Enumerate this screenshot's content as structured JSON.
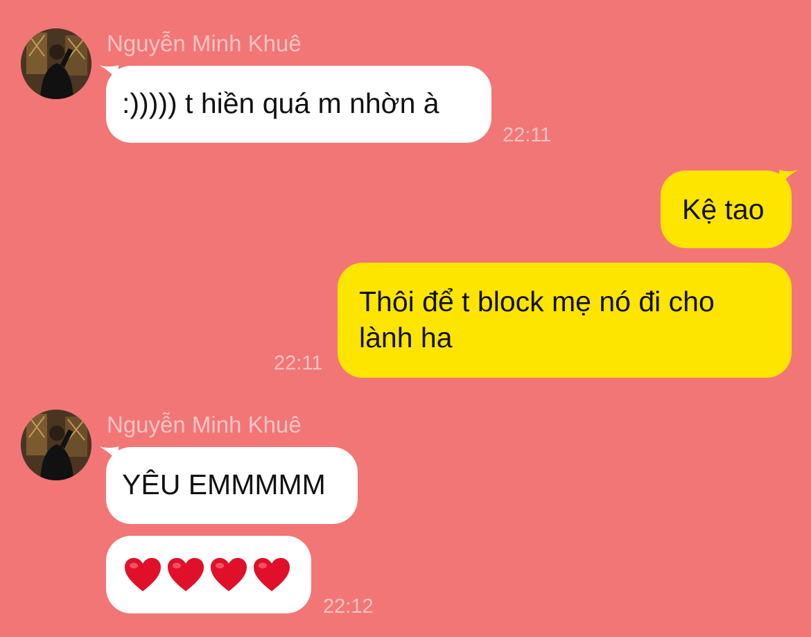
{
  "colors": {
    "background": "#F27676",
    "incoming_bubble": "#FFFFFF",
    "outgoing_bubble": "#FEE500",
    "meta_text": "#F9C4C4",
    "heart": "#E0102B"
  },
  "messages": [
    {
      "direction": "incoming",
      "sender": "Nguyễn Minh Khuê",
      "avatar_icon": "user-photo-avatar",
      "text": ":))))) t hiền quá m nhờn à",
      "time": "22:11"
    },
    {
      "direction": "outgoing",
      "text": "Kệ tao",
      "time": ""
    },
    {
      "direction": "outgoing",
      "text_line1": "Thôi để t block mẹ nó đi cho",
      "text_line2": "lành ha",
      "time": "22:11"
    },
    {
      "direction": "incoming",
      "sender": "Nguyễn Minh Khuê",
      "avatar_icon": "user-photo-avatar",
      "text": "YÊU EMMMMM"
    },
    {
      "direction": "incoming",
      "emoji": [
        "red-heart-icon",
        "red-heart-icon",
        "red-heart-icon",
        "red-heart-icon"
      ],
      "time": "22:12"
    }
  ]
}
